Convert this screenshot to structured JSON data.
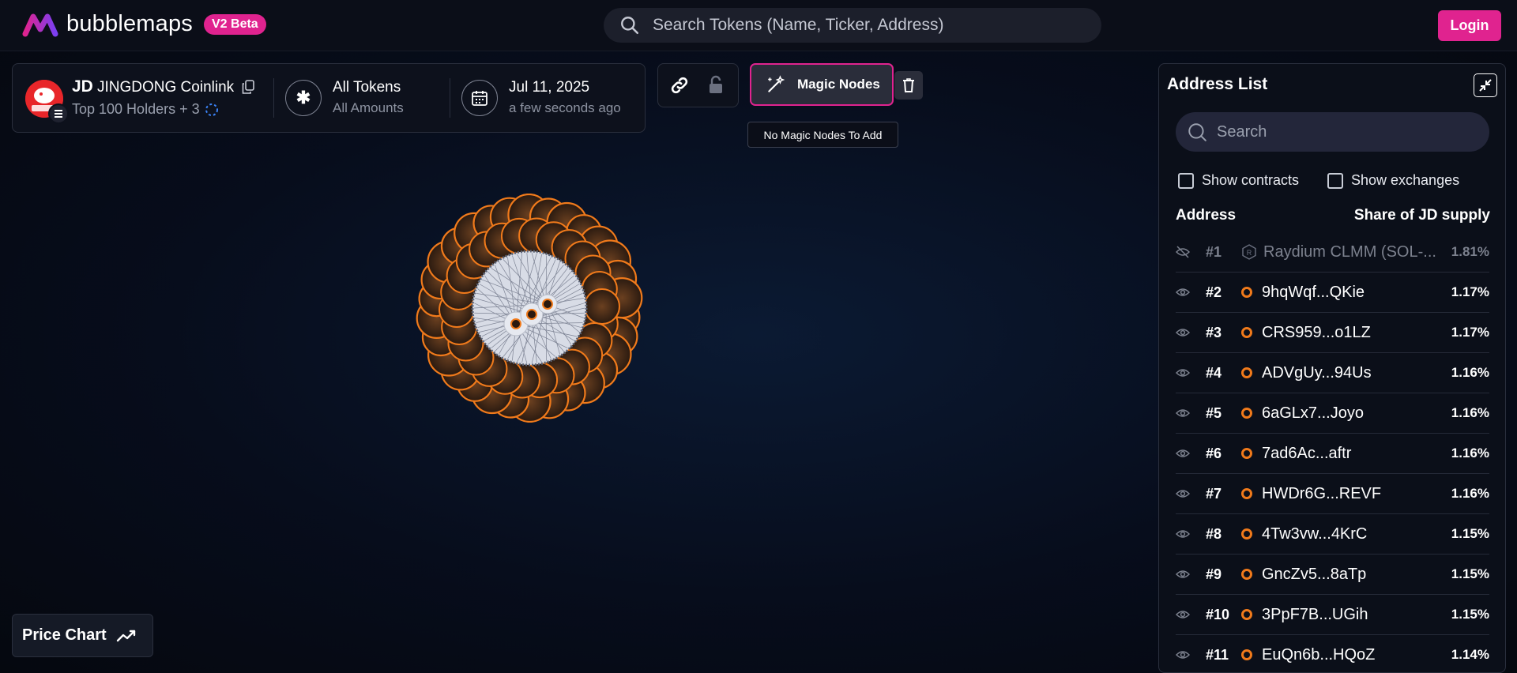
{
  "header": {
    "logo_text": "bubblemaps",
    "beta_badge": "V2 Beta",
    "search_placeholder": "Search Tokens (Name, Ticker, Address)",
    "login_label": "Login"
  },
  "token": {
    "symbol": "JD",
    "name": "JINGDONG Coinlink",
    "holders_label": "Top 100 Holders + 3",
    "filter_title": "All Tokens",
    "filter_sub": "All Amounts",
    "date_title": "Jul 11, 2025",
    "date_sub": "a few seconds ago"
  },
  "toolbar": {
    "magic_label": "Magic Nodes",
    "tooltip": "No Magic Nodes To Add"
  },
  "price_chart_label": "Price Chart",
  "address_list": {
    "title": "Address List",
    "search_placeholder": "Search",
    "show_contracts": "Show contracts",
    "show_exchanges": "Show exchanges",
    "col_address": "Address",
    "col_share": "Share of JD supply",
    "rows": [
      {
        "rank": "#1",
        "address": "Raydium CLMM (SOL-...",
        "share": "1.81%",
        "hidden": true
      },
      {
        "rank": "#2",
        "address": "9hqWqf...QKie",
        "share": "1.17%",
        "hidden": false
      },
      {
        "rank": "#3",
        "address": "CRS959...o1LZ",
        "share": "1.17%",
        "hidden": false
      },
      {
        "rank": "#4",
        "address": "ADVgUy...94Us",
        "share": "1.16%",
        "hidden": false
      },
      {
        "rank": "#5",
        "address": "6aGLx7...Joyo",
        "share": "1.16%",
        "hidden": false
      },
      {
        "rank": "#6",
        "address": "7ad6Ac...aftr",
        "share": "1.16%",
        "hidden": false
      },
      {
        "rank": "#7",
        "address": "HWDr6G...REVF",
        "share": "1.16%",
        "hidden": false
      },
      {
        "rank": "#8",
        "address": "4Tw3vw...4KrC",
        "share": "1.15%",
        "hidden": false
      },
      {
        "rank": "#9",
        "address": "GncZv5...8aTp",
        "share": "1.15%",
        "hidden": false
      },
      {
        "rank": "#10",
        "address": "3PpF7B...UGih",
        "share": "1.15%",
        "hidden": false
      },
      {
        "rank": "#11",
        "address": "EuQn6b...HQoZ",
        "share": "1.14%",
        "hidden": false
      }
    ]
  },
  "colors": {
    "accent": "#e0238f",
    "bubble_orange": "#f07a1b",
    "background": "#070d1c"
  }
}
